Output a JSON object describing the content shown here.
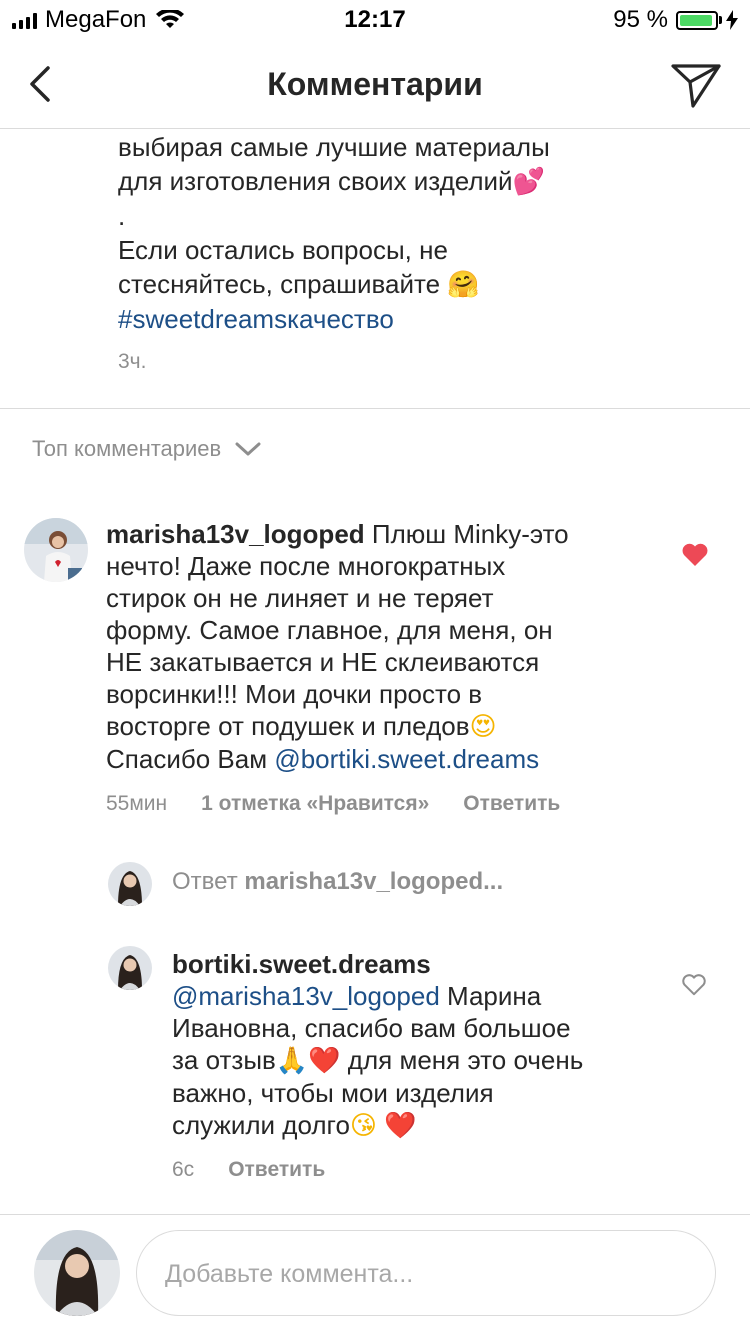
{
  "status_bar": {
    "carrier": "MegaFon",
    "time": "12:17",
    "battery": "95 %",
    "battery_level": 0.95
  },
  "header": {
    "title": "Комментарии"
  },
  "caption": {
    "lines": [
      "выбирая самые лучшие материалы",
      "для изготовления своих изделий",
      ".",
      "Если остались вопросы, не",
      "стесняйтесь, спрашивайте"
    ],
    "hashtag": "#sweetdreamsкачество",
    "time": "3ч."
  },
  "top_comments": {
    "label": "Топ комментариев"
  },
  "comment": {
    "username": "marisha13v_logoped",
    "text_lines": [
      " Плюш Minky-это",
      "нечто! Даже после многократных",
      "стирок он не линяет и не теряет",
      "форму. Самое главное, для меня, он",
      "НЕ закатывается и НЕ склеиваются",
      "ворсинки!!! Мои дочки просто в",
      "восторге от подушек и пледов"
    ],
    "last_line_prefix": "Спасибо Вам ",
    "mention": "@bortiki.sweet.dreams",
    "time": "55мин",
    "likes": "1 отметка «Нравится»",
    "reply_label": "Ответить",
    "liked": true
  },
  "reply_toggle": {
    "prefix": "Ответ ",
    "username": "marisha13v_logoped..."
  },
  "reply": {
    "username": "bortiki.sweet.dreams",
    "mention": "@marisha13v_logoped",
    "line1_rest": " Марина",
    "lines": [
      "Ивановна, спасибо вам большое",
      "за отзыв",
      " для меня это очень",
      "важно, чтобы мои изделия",
      "служили долго"
    ],
    "time": "6с",
    "reply_label": "Ответить",
    "liked": false
  },
  "input": {
    "placeholder": "Добавьте коммента..."
  },
  "colors": {
    "heart_active": "#ed4956",
    "link": "#1d4f87",
    "muted": "#8e8e8e"
  },
  "icons": [
    "signal-icon",
    "wifi-icon",
    "battery-icon",
    "charging-icon",
    "back-arrow-icon",
    "direct-send-icon",
    "chevron-down-icon",
    "heart-filled-icon",
    "heart-outline-icon"
  ]
}
